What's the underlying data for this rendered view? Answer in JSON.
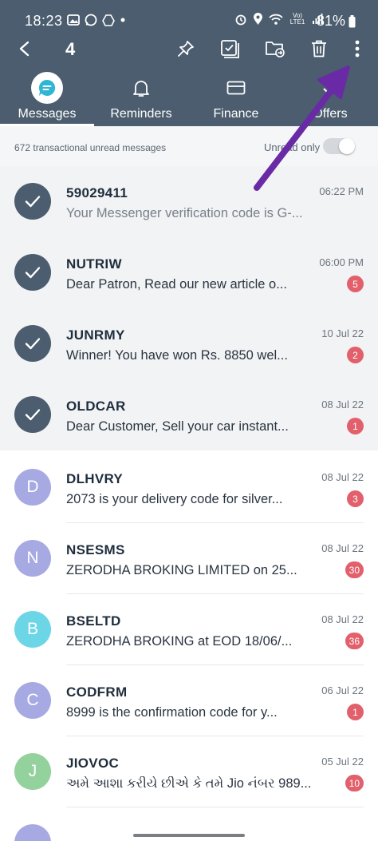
{
  "status_bar": {
    "time": "18:23",
    "network": "Vo) LTE1",
    "battery": "81%"
  },
  "toolbar": {
    "selected_count": "4",
    "icons": [
      "back-arrow-icon",
      "pin-icon",
      "select-all-icon",
      "move-folder-icon",
      "delete-icon",
      "more-options-icon"
    ]
  },
  "tabs": [
    {
      "label": "Messages",
      "icon": "chat-bubble-icon",
      "active": true
    },
    {
      "label": "Reminders",
      "icon": "bell-icon",
      "active": false
    },
    {
      "label": "Finance",
      "icon": "card-icon",
      "active": false
    },
    {
      "label": "Offers",
      "icon": "check-icon",
      "active": false
    }
  ],
  "summary": {
    "text": "672 transactional unread messages",
    "unread_only_label": "Unread only",
    "unread_only_on": false
  },
  "colors": {
    "header": "#4b5d6e",
    "badge": "#e2606b",
    "selected_avatar": "#4b5d6e",
    "annotation_arrow": "#6a2aa6"
  },
  "messages": [
    {
      "sender": "59029411",
      "preview": "Your Messenger verification code is G-...",
      "time": "06:22 PM",
      "selected": true,
      "read": true,
      "badge": "",
      "initial": "",
      "color": "#4b5d6e"
    },
    {
      "sender": "NUTRIW",
      "preview": "Dear Patron, Read our new article o...",
      "time": "06:00 PM",
      "selected": true,
      "read": false,
      "badge": "5",
      "initial": "",
      "color": "#4b5d6e"
    },
    {
      "sender": "JUNRMY",
      "preview": "Winner! You have won Rs. 8850 wel...",
      "time": "10 Jul 22",
      "selected": true,
      "read": false,
      "badge": "2",
      "initial": "",
      "color": "#4b5d6e"
    },
    {
      "sender": "OLDCAR",
      "preview": "Dear Customer, Sell your car instant...",
      "time": "08 Jul 22",
      "selected": true,
      "read": false,
      "badge": "1",
      "initial": "",
      "color": "#4b5d6e"
    },
    {
      "sender": "DLHVRY",
      "preview": "2073 is your delivery code for silver...",
      "time": "08 Jul 22",
      "selected": false,
      "read": false,
      "badge": "3",
      "initial": "D",
      "color": "#a7a9e3"
    },
    {
      "sender": "NSESMS",
      "preview": "ZERODHA BROKING LIMITED on 25...",
      "time": "08 Jul 22",
      "selected": false,
      "read": false,
      "badge": "30",
      "initial": "N",
      "color": "#a7a9e3"
    },
    {
      "sender": "BSELTD",
      "preview": "ZERODHA BROKING at EOD 18/06/...",
      "time": "08 Jul 22",
      "selected": false,
      "read": false,
      "badge": "36",
      "initial": "B",
      "color": "#6dd6e6"
    },
    {
      "sender": "CODFRM",
      "preview": "8999 is the confirmation code for y...",
      "time": "06 Jul 22",
      "selected": false,
      "read": false,
      "badge": "1",
      "initial": "C",
      "color": "#a7a9e3"
    },
    {
      "sender": "JIOVOC",
      "preview": "અમે આશા કરીયે છીએ કે તમે Jio નંબર 989...",
      "time": "05 Jul 22",
      "selected": false,
      "read": false,
      "badge": "10",
      "initial": "J",
      "color": "#93d19d"
    }
  ]
}
